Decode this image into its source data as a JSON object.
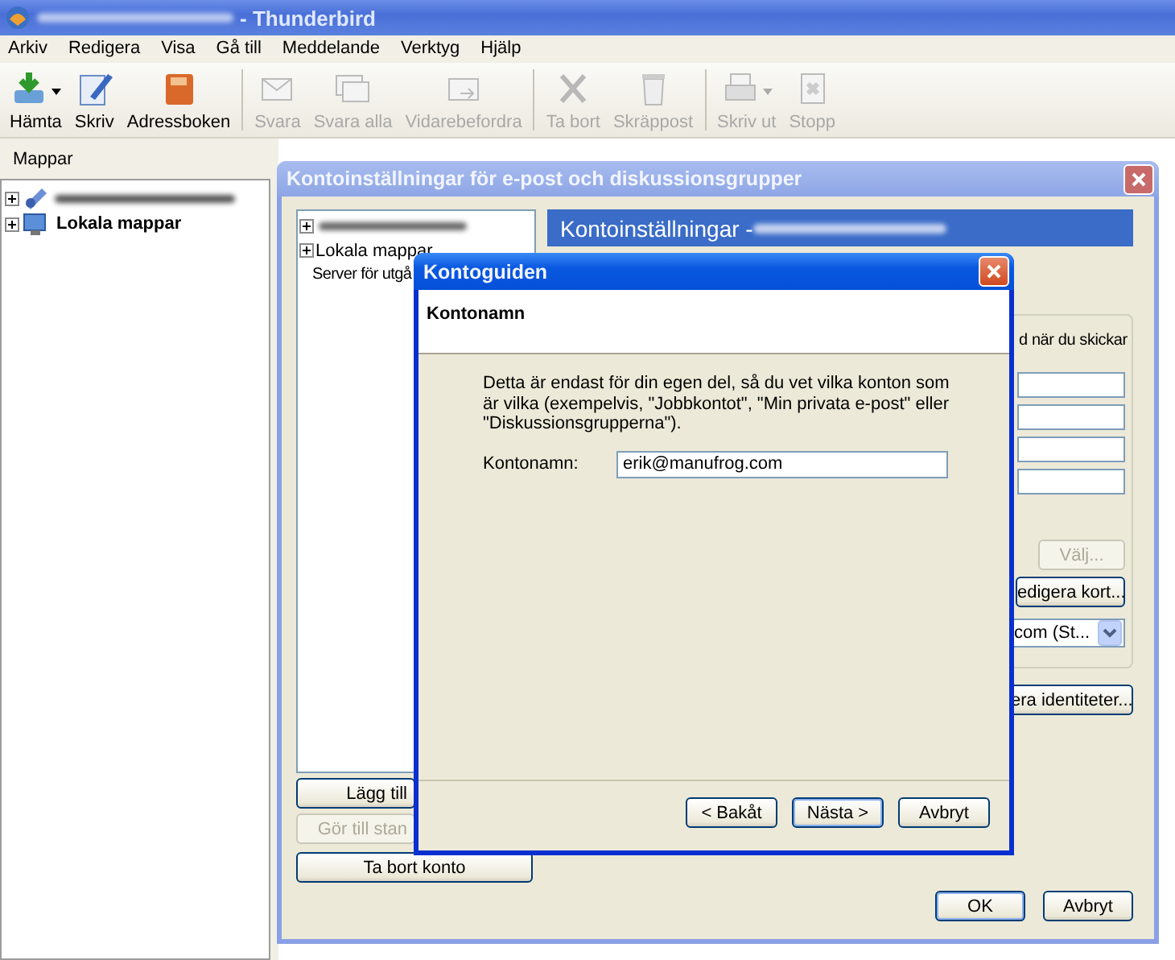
{
  "window": {
    "title": "- Thunderbird"
  },
  "menu": [
    "Arkiv",
    "Redigera",
    "Visa",
    "Gå till",
    "Meddelande",
    "Verktyg",
    "Hjälp"
  ],
  "toolbar": [
    {
      "label": "Hämta",
      "kind": "get",
      "disabled": false,
      "dropdown": true,
      "separator_before": false
    },
    {
      "label": "Skriv",
      "kind": "write",
      "disabled": false,
      "dropdown": false,
      "separator_before": false
    },
    {
      "label": "Adressboken",
      "kind": "book",
      "disabled": false,
      "dropdown": false,
      "separator_before": false
    },
    {
      "label": "Svara",
      "kind": "reply",
      "disabled": true,
      "dropdown": false,
      "separator_before": true
    },
    {
      "label": "Svara alla",
      "kind": "replyall",
      "disabled": true,
      "dropdown": false,
      "separator_before": false
    },
    {
      "label": "Vidarebefordra",
      "kind": "forward",
      "disabled": true,
      "dropdown": false,
      "separator_before": false
    },
    {
      "label": "Ta bort",
      "kind": "delete",
      "disabled": true,
      "dropdown": false,
      "separator_before": true
    },
    {
      "label": "Skräppost",
      "kind": "junk",
      "disabled": true,
      "dropdown": false,
      "separator_before": false
    },
    {
      "label": "Skriv ut",
      "kind": "print",
      "disabled": true,
      "dropdown": true,
      "separator_before": true
    },
    {
      "label": "Stopp",
      "kind": "stop",
      "disabled": true,
      "dropdown": false,
      "separator_before": false
    }
  ],
  "folder_pane": {
    "title": "Mappar",
    "items": [
      {
        "kind": "account",
        "expanded": false
      },
      {
        "kind": "local",
        "label": "Lokala mappar",
        "expanded": false
      }
    ]
  },
  "account_settings": {
    "title": "Kontoinställningar för e-post och diskussionsgrupper",
    "active": false,
    "tree": [
      {
        "expanded": false
      },
      {
        "label": "Lokala mappar",
        "expanded": false
      },
      {
        "label": "Server för utgå"
      }
    ],
    "left_buttons": [
      {
        "label": "Lägg till",
        "disabled": false,
        "kind": "short"
      },
      {
        "label": "Gör till stan",
        "disabled": true,
        "kind": "short"
      },
      {
        "label": "Ta bort konto",
        "disabled": false,
        "kind": "wide"
      }
    ],
    "header": {
      "title": "Kontoinställningar - "
    },
    "group_items": [
      {
        "kind": "text",
        "label": "d när du skickar"
      },
      {
        "kind": "field"
      },
      {
        "kind": "field"
      },
      {
        "kind": "field"
      },
      {
        "kind": "field"
      },
      {
        "kind": "button",
        "label": "Välj...",
        "disabled": true
      },
      {
        "kind": "button",
        "label": "edigera kort...",
        "disabled": false
      },
      {
        "kind": "dropdown",
        "label": "com (St..."
      }
    ],
    "identities_button": "era identiteter...",
    "footer_buttons": [
      {
        "label": "OK",
        "default": true
      },
      {
        "label": "Avbryt",
        "default": false
      }
    ]
  },
  "account_wizard": {
    "title": "Kontoguiden",
    "active": true,
    "heading": "Kontonamn",
    "description": "Detta är endast för din egen del, så du vet vilka konton som är vilka (exempelvis, \"Jobbkontot\", \"Min privata e-post\" eller \"Diskussionsgrupperna\").",
    "field_label": "Kontonamn:",
    "field_value": "erik@manufrog.com",
    "buttons": [
      {
        "label": "< Bakåt",
        "default": false
      },
      {
        "label": "Nästa >",
        "default": true
      },
      {
        "label": "Avbryt",
        "default": false
      }
    ]
  }
}
